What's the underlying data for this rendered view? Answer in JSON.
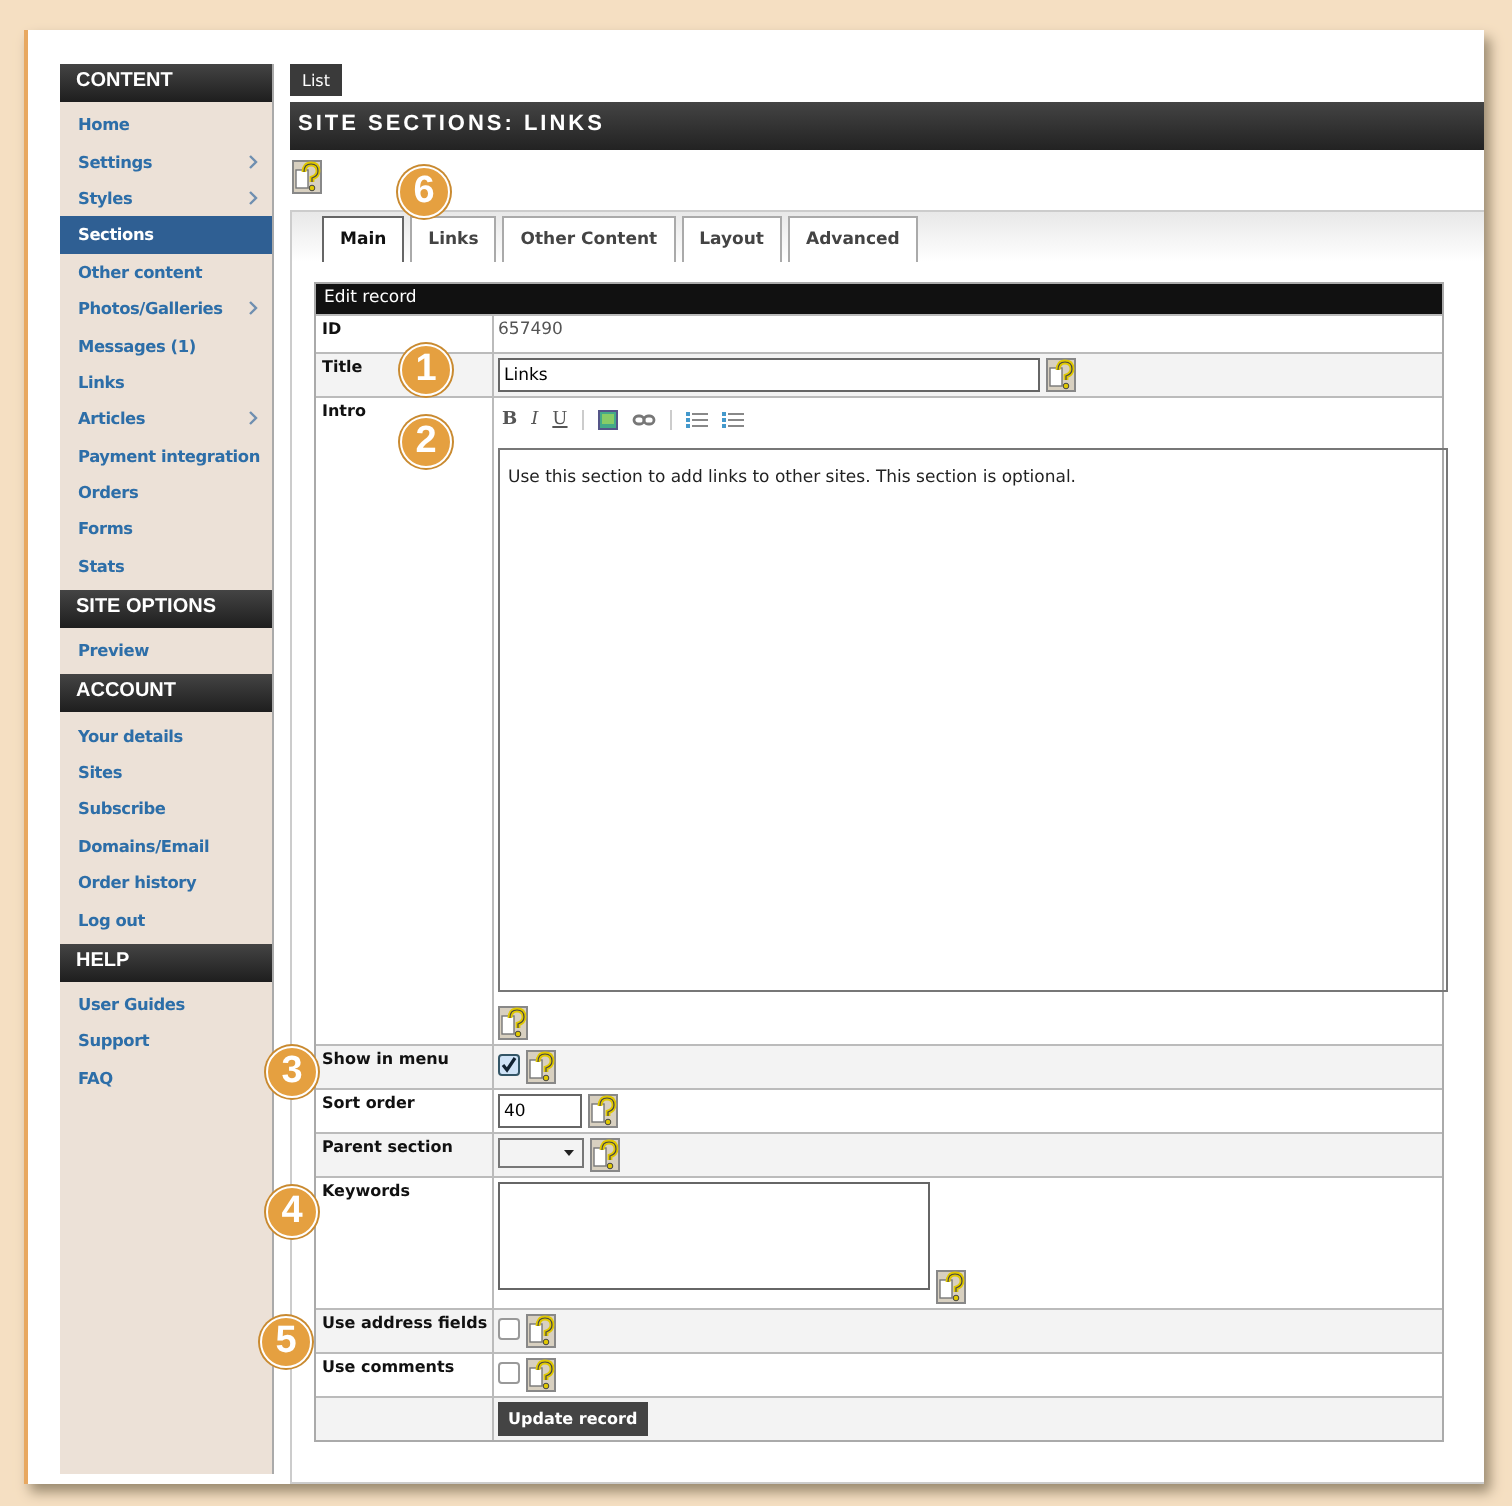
{
  "sidebar": [
    {
      "heading": "CONTENT",
      "items": [
        {
          "label": "Home",
          "submenu": false,
          "selected": false
        },
        {
          "label": "Settings",
          "submenu": true,
          "selected": false
        },
        {
          "label": "Styles",
          "submenu": true,
          "selected": false
        },
        {
          "label": "Sections",
          "submenu": false,
          "selected": true
        },
        {
          "label": "Other content",
          "submenu": false,
          "selected": false
        },
        {
          "label": "Photos/Galleries",
          "submenu": true,
          "selected": false
        },
        {
          "label": "Messages (1)",
          "submenu": false,
          "selected": false
        },
        {
          "label": "Links",
          "submenu": false,
          "selected": false
        },
        {
          "label": "Articles",
          "submenu": true,
          "selected": false
        },
        {
          "label": "Payment integration",
          "submenu": false,
          "selected": false
        },
        {
          "label": "Orders",
          "submenu": false,
          "selected": false
        },
        {
          "label": "Forms",
          "submenu": false,
          "selected": false
        },
        {
          "label": "Stats",
          "submenu": false,
          "selected": false
        }
      ]
    },
    {
      "heading": "SITE OPTIONS",
      "items": [
        {
          "label": "Preview",
          "submenu": false,
          "selected": false
        }
      ]
    },
    {
      "heading": "ACCOUNT",
      "items": [
        {
          "label": "Your details",
          "submenu": false,
          "selected": false
        },
        {
          "label": "Sites",
          "submenu": false,
          "selected": false
        },
        {
          "label": "Subscribe",
          "submenu": false,
          "selected": false
        },
        {
          "label": "Domains/Email",
          "submenu": false,
          "selected": false
        },
        {
          "label": "Order history",
          "submenu": false,
          "selected": false
        },
        {
          "label": "Log out",
          "submenu": false,
          "selected": false
        }
      ]
    },
    {
      "heading": "HELP",
      "items": [
        {
          "label": "User Guides",
          "submenu": false,
          "selected": false
        },
        {
          "label": "Support",
          "submenu": false,
          "selected": false
        },
        {
          "label": "FAQ",
          "submenu": false,
          "selected": false
        }
      ]
    }
  ],
  "list_button": "List",
  "page_title": "SITE SECTIONS: LINKS",
  "tabs": [
    {
      "label": "Main",
      "selected": true
    },
    {
      "label": "Links",
      "selected": false
    },
    {
      "label": "Other Content",
      "selected": false
    },
    {
      "label": "Layout",
      "selected": false
    },
    {
      "label": "Advanced",
      "selected": false
    }
  ],
  "form": {
    "header": "Edit record",
    "rows": [
      {
        "kind": "static",
        "label": "ID",
        "value": "657490"
      },
      {
        "kind": "text",
        "label": "Title",
        "value": "Links"
      },
      {
        "kind": "editor",
        "label": "Intro",
        "toolbar": [
          "B",
          "I",
          "U"
        ],
        "value": "Use this section to add links to other sites. This section is optional."
      },
      {
        "kind": "checkbox",
        "label": "Show in menu",
        "checked": true
      },
      {
        "kind": "number",
        "label": "Sort order",
        "value": "40"
      },
      {
        "kind": "select",
        "label": "Parent section"
      },
      {
        "kind": "textarea",
        "label": "Keywords"
      },
      {
        "kind": "checkbox",
        "label": "Use address fields",
        "checked": false
      },
      {
        "kind": "checkbox",
        "label": "Use comments",
        "checked": false
      },
      {
        "kind": "submit",
        "label": "Update record"
      }
    ]
  },
  "callouts": [
    {
      "number": "6"
    },
    {
      "number": "1"
    },
    {
      "number": "2"
    },
    {
      "number": "3"
    },
    {
      "number": "4"
    },
    {
      "number": "5"
    }
  ]
}
